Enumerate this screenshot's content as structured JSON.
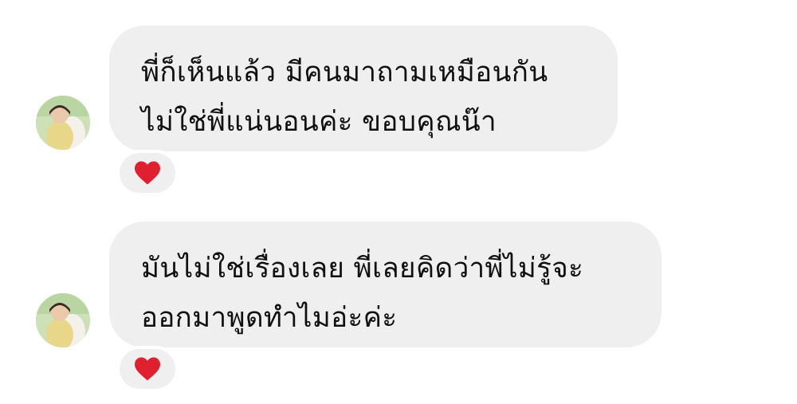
{
  "messages": [
    {
      "lines": [
        "พี่ก็เห็นแล้ว มีคนมาถามเหมือนกัน",
        "ไม่ใช่พี่แน่นอนค่ะ ขอบคุณน๊า"
      ],
      "reaction_icon": "heart-icon"
    },
    {
      "lines": [
        "มันไม่ใช่เรื่องเลย พี่เลยคิดว่าพี่ไม่รู้จะ",
        "ออกมาพูดทำไมอ่ะค่ะ"
      ],
      "reaction_icon": "heart-icon"
    }
  ],
  "colors": {
    "bubble_background": "#efefef",
    "reaction_heart": "#e0202e",
    "text": "#101010"
  }
}
